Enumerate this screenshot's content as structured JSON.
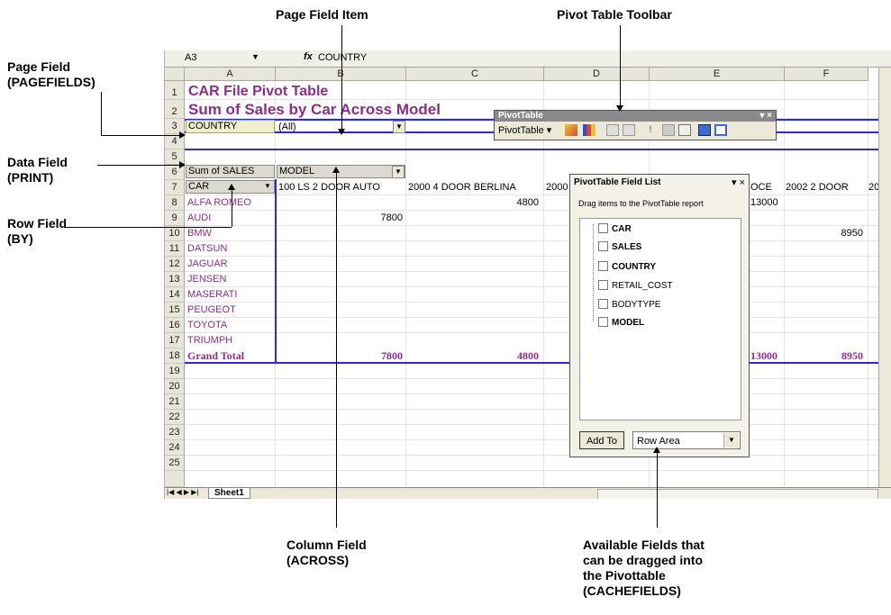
{
  "annotations": {
    "page_field_item": "Page Field Item",
    "pivot_table_toolbar": "Pivot Table Toolbar",
    "page_field": "Page Field\n(PAGEFIELDS)",
    "data_field": "Data Field\n(PRINT)",
    "row_field": "Row Field\n(BY)",
    "column_field": "Column Field\n(ACROSS)",
    "available_fields": "Available Fields that\ncan be dragged into\nthe Pivottable\n(CACHEFIELDS)"
  },
  "formula_bar": {
    "name_box": "A3",
    "fx": "fx",
    "content": "COUNTRY"
  },
  "columns": [
    "A",
    "B",
    "C",
    "D",
    "E",
    "F"
  ],
  "rows": [
    "1",
    "2",
    "3",
    "4",
    "5",
    "6",
    "7",
    "8",
    "9",
    "10",
    "11",
    "12",
    "13",
    "14",
    "15",
    "16",
    "17",
    "18",
    "19",
    "20",
    "21",
    "22",
    "23",
    "24",
    "25"
  ],
  "sheet": {
    "title1": "CAR File Pivot Table",
    "title2": "Sum of Sales by Car Across Model",
    "page_field": "COUNTRY",
    "page_value": "(All)",
    "data_field": "Sum of SALES",
    "column_field": "MODEL",
    "row_field": "CAR",
    "col_headers": [
      "100 LS 2 DOOR AUTO",
      "2000 4 DOOR BERLINA",
      "2000",
      "OCE",
      "2002 2 DOOR",
      "200"
    ],
    "row_labels": [
      "ALFA ROMEO",
      "AUDI",
      "BMW",
      "DATSUN",
      "JAGUAR",
      "JENSEN",
      "MASERATI",
      "PEUGEOT",
      "TOYOTA",
      "TRIUMPH"
    ],
    "grand_total_label": "Grand Total",
    "values": {
      "alfa_c": "4800",
      "alfa_e": "13000",
      "audi_b": "7800",
      "bmw_f": "8950",
      "gt_b": "7800",
      "gt_c": "4800",
      "gt_e": "13000",
      "gt_f": "8950"
    }
  },
  "sheet_tab": "Sheet1",
  "pivot_toolbar": {
    "title": "PivotTable",
    "menu": "PivotTable ▾",
    "close": "▾ ×"
  },
  "field_list": {
    "title": "PivotTable Field List",
    "controls": "▾ ×",
    "description": "Drag items to the PivotTable report",
    "items": [
      {
        "label": "CAR",
        "bold": true
      },
      {
        "label": "SALES",
        "bold": true
      },
      {
        "label": "COUNTRY",
        "bold": true
      },
      {
        "label": "RETAIL_COST",
        "bold": false
      },
      {
        "label": "BODYTYPE",
        "bold": false
      },
      {
        "label": "MODEL",
        "bold": true
      }
    ],
    "add_to": "Add To",
    "area": "Row Area"
  },
  "colors": {
    "title_purple": "#8b2d8b",
    "pivot_border_blue": "#2b2bcf",
    "header_grey": "#e8e6da"
  }
}
